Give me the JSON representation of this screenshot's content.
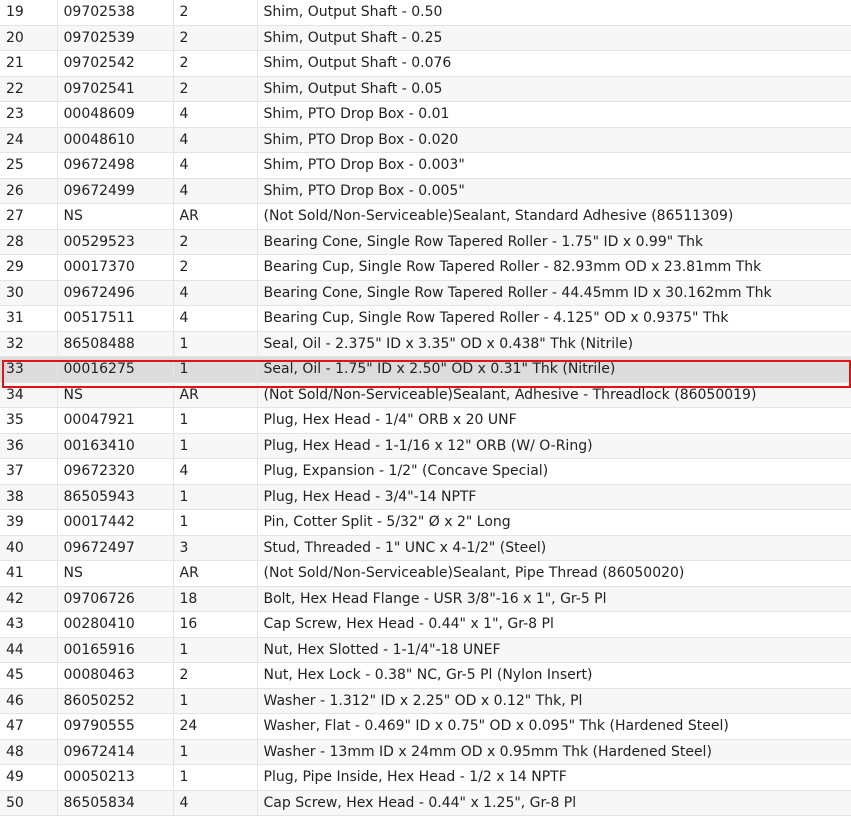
{
  "highlight_color": "#e01414",
  "selected_item": "33",
  "rows": [
    {
      "item": "19",
      "part": "09702538",
      "qty": "2",
      "desc": "Shim, Output Shaft - 0.50"
    },
    {
      "item": "20",
      "part": "09702539",
      "qty": "2",
      "desc": "Shim, Output Shaft - 0.25"
    },
    {
      "item": "21",
      "part": "09702542",
      "qty": "2",
      "desc": "Shim, Output Shaft - 0.076"
    },
    {
      "item": "22",
      "part": "09702541",
      "qty": "2",
      "desc": "Shim, Output Shaft - 0.05"
    },
    {
      "item": "23",
      "part": "00048609",
      "qty": "4",
      "desc": "Shim, PTO Drop Box - 0.01"
    },
    {
      "item": "24",
      "part": "00048610",
      "qty": "4",
      "desc": "Shim, PTO Drop Box - 0.020"
    },
    {
      "item": "25",
      "part": "09672498",
      "qty": "4",
      "desc": "Shim, PTO Drop Box - 0.003\""
    },
    {
      "item": "26",
      "part": "09672499",
      "qty": "4",
      "desc": "Shim, PTO Drop Box - 0.005\""
    },
    {
      "item": "27",
      "part": "NS",
      "qty": "AR",
      "desc": "(Not Sold/Non-Serviceable)Sealant, Standard Adhesive (86511309)"
    },
    {
      "item": "28",
      "part": "00529523",
      "qty": "2",
      "desc": "Bearing Cone, Single Row Tapered Roller - 1.75\" ID x 0.99\" Thk"
    },
    {
      "item": "29",
      "part": "00017370",
      "qty": "2",
      "desc": "Bearing Cup, Single Row Tapered Roller - 82.93mm OD x 23.81mm Thk"
    },
    {
      "item": "30",
      "part": "09672496",
      "qty": "4",
      "desc": "Bearing Cone, Single Row Tapered Roller - 44.45mm ID x 30.162mm Thk"
    },
    {
      "item": "31",
      "part": "00517511",
      "qty": "4",
      "desc": "Bearing Cup, Single Row Tapered Roller - 4.125\" OD x 0.9375\" Thk"
    },
    {
      "item": "32",
      "part": "86508488",
      "qty": "1",
      "desc": "Seal, Oil - 2.375\" ID x 3.35\" OD x 0.438\" Thk (Nitrile)"
    },
    {
      "item": "33",
      "part": "00016275",
      "qty": "1",
      "desc": "Seal, Oil - 1.75\" ID x 2.50\" OD x 0.31\" Thk (Nitrile)"
    },
    {
      "item": "34",
      "part": "NS",
      "qty": "AR",
      "desc": "(Not Sold/Non-Serviceable)Sealant, Adhesive - Threadlock (86050019)"
    },
    {
      "item": "35",
      "part": "00047921",
      "qty": "1",
      "desc": "Plug, Hex Head - 1/4\" ORB x 20 UNF"
    },
    {
      "item": "36",
      "part": "00163410",
      "qty": "1",
      "desc": "Plug, Hex Head - 1-1/16 x 12\" ORB (W/ O-Ring)"
    },
    {
      "item": "37",
      "part": "09672320",
      "qty": "4",
      "desc": "Plug, Expansion - 1/2\" (Concave Special)"
    },
    {
      "item": "38",
      "part": "86505943",
      "qty": "1",
      "desc": "Plug, Hex Head - 3/4\"-14 NPTF"
    },
    {
      "item": "39",
      "part": "00017442",
      "qty": "1",
      "desc": "Pin, Cotter Split - 5/32\" Ø x 2\" Long"
    },
    {
      "item": "40",
      "part": "09672497",
      "qty": "3",
      "desc": "Stud, Threaded - 1\" UNC x 4-1/2\" (Steel)"
    },
    {
      "item": "41",
      "part": "NS",
      "qty": "AR",
      "desc": "(Not Sold/Non-Serviceable)Sealant, Pipe Thread (86050020)"
    },
    {
      "item": "42",
      "part": "09706726",
      "qty": "18",
      "desc": "Bolt, Hex Head Flange - USR 3/8\"-16 x 1\", Gr-5 Pl"
    },
    {
      "item": "43",
      "part": "00280410",
      "qty": "16",
      "desc": "Cap Screw, Hex Head - 0.44\" x 1\", Gr-8 Pl"
    },
    {
      "item": "44",
      "part": "00165916",
      "qty": "1",
      "desc": "Nut, Hex Slotted - 1-1/4\"-18 UNEF"
    },
    {
      "item": "45",
      "part": "00080463",
      "qty": "2",
      "desc": "Nut, Hex Lock - 0.38\" NC, Gr-5 Pl (Nylon Insert)"
    },
    {
      "item": "46",
      "part": "86050252",
      "qty": "1",
      "desc": "Washer - 1.312\" ID x 2.25\" OD x 0.12\" Thk, Pl"
    },
    {
      "item": "47",
      "part": "09790555",
      "qty": "24",
      "desc": "Washer, Flat - 0.469\" ID x 0.75\" OD x 0.095\" Thk (Hardened Steel)"
    },
    {
      "item": "48",
      "part": "09672414",
      "qty": "1",
      "desc": "Washer - 13mm ID x 24mm OD x 0.95mm Thk (Hardened Steel)"
    },
    {
      "item": "49",
      "part": "00050213",
      "qty": "1",
      "desc": "Plug, Pipe Inside, Hex Head - 1/2 x 14 NPTF"
    },
    {
      "item": "50",
      "part": "86505834",
      "qty": "4",
      "desc": "Cap Screw, Hex Head - 0.44\" x 1.25\", Gr-8 Pl"
    }
  ]
}
